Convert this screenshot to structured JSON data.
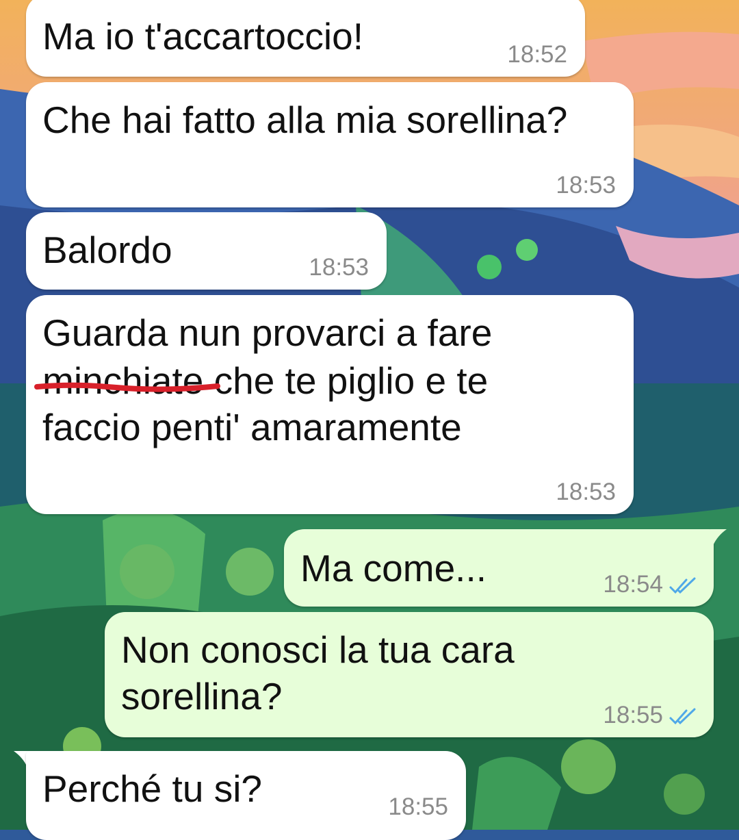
{
  "colors": {
    "incoming_bubble": "#ffffff",
    "outgoing_bubble": "#e7fed9",
    "timestamp": "#8a8a8a",
    "read_ticks": "#4fa8e8",
    "scribble": "#d8202a"
  },
  "messages": [
    {
      "direction": "incoming",
      "lines": [
        "Ma io t'accartoccio!"
      ],
      "time": "18:52"
    },
    {
      "direction": "incoming",
      "lines": [
        "Che hai fatto alla mia sorellina?"
      ],
      "time": "18:53"
    },
    {
      "direction": "incoming",
      "lines": [
        "Balordo"
      ],
      "time": "18:53"
    },
    {
      "direction": "incoming",
      "lines": [
        "Guarda nun provarci a fare",
        "minchiate che te piglio e te",
        "faccio penti' amaramente"
      ],
      "time": "18:53"
    },
    {
      "direction": "outgoing",
      "lines": [
        "Ma come..."
      ],
      "time": "18:54",
      "status": "double-check-read-icon"
    },
    {
      "direction": "outgoing",
      "lines": [
        "Non conosci la tua cara",
        "sorellina?"
      ],
      "time": "18:55",
      "status": "double-check-read-icon"
    },
    {
      "direction": "incoming",
      "lines": [
        "Perché tu si?"
      ],
      "time": "18:55"
    }
  ]
}
